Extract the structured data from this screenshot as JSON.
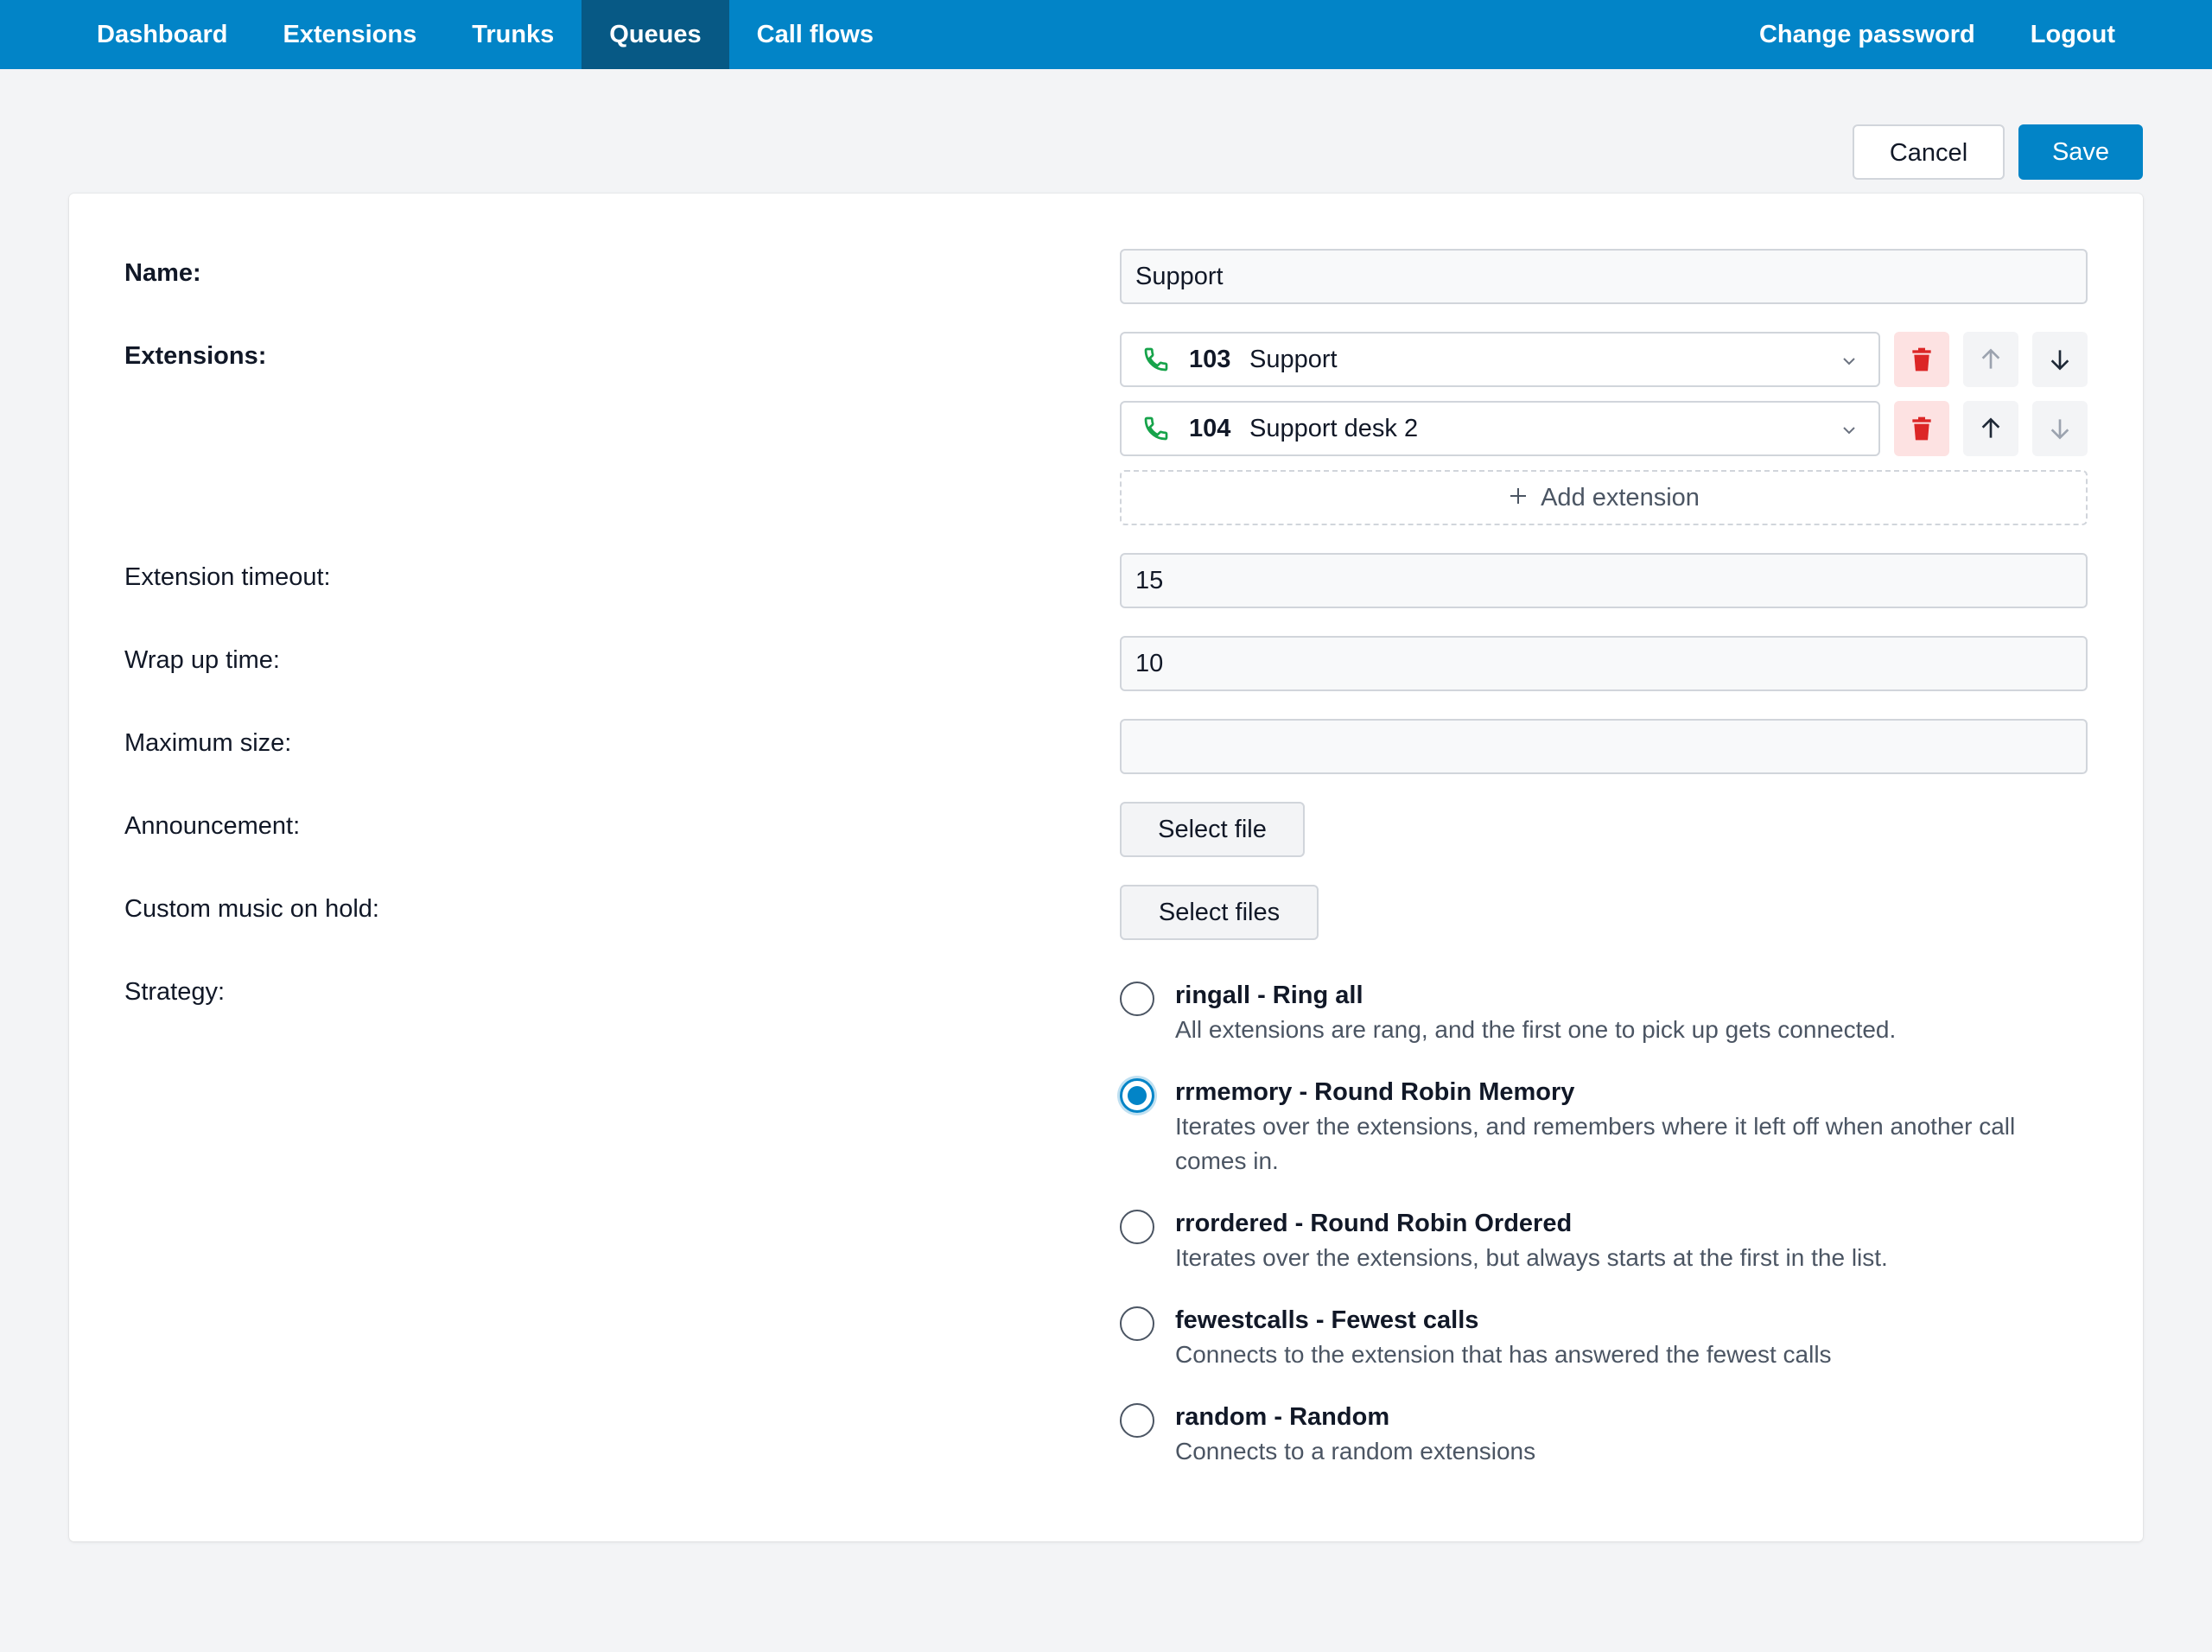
{
  "nav": {
    "left": [
      "Dashboard",
      "Extensions",
      "Trunks",
      "Queues",
      "Call flows"
    ],
    "active": "Queues",
    "right": [
      "Change password",
      "Logout"
    ]
  },
  "actions": {
    "cancel": "Cancel",
    "save": "Save"
  },
  "form": {
    "name_label": "Name:",
    "name_value": "Support",
    "extensions_label": "Extensions:",
    "extensions": [
      {
        "number": "103",
        "name": "Support"
      },
      {
        "number": "104",
        "name": "Support desk 2"
      }
    ],
    "add_extension": "Add extension",
    "extension_timeout_label": "Extension timeout:",
    "extension_timeout_value": "15",
    "wrap_up_label": "Wrap up time:",
    "wrap_up_value": "10",
    "max_size_label": "Maximum size:",
    "max_size_value": "",
    "announcement_label": "Announcement:",
    "announcement_button": "Select file",
    "moh_label": "Custom music on hold:",
    "moh_button": "Select files",
    "strategy_label": "Strategy:",
    "strategies": [
      {
        "title": "ringall - Ring all",
        "desc": "All extensions are rang, and the first one to pick up gets connected.",
        "checked": false
      },
      {
        "title": "rrmemory - Round Robin Memory",
        "desc": "Iterates over the extensions, and remembers where it left off when another call comes in.",
        "checked": true
      },
      {
        "title": "rrordered - Round Robin Ordered",
        "desc": "Iterates over the extensions, but always starts at the first in the list.",
        "checked": false
      },
      {
        "title": "fewestcalls - Fewest calls",
        "desc": "Connects to the extension that has answered the fewest calls",
        "checked": false
      },
      {
        "title": "random - Random",
        "desc": "Connects to a random extensions",
        "checked": false
      }
    ]
  },
  "colors": {
    "nav_bg": "#0284c7",
    "nav_active": "#075985",
    "accent": "#0284c7",
    "delete": "#dc2626",
    "phone": "#16a34a"
  },
  "icons": [
    "phone-icon",
    "chevron-down-icon",
    "trash-icon",
    "arrow-up-icon",
    "arrow-down-icon",
    "plus-icon"
  ]
}
